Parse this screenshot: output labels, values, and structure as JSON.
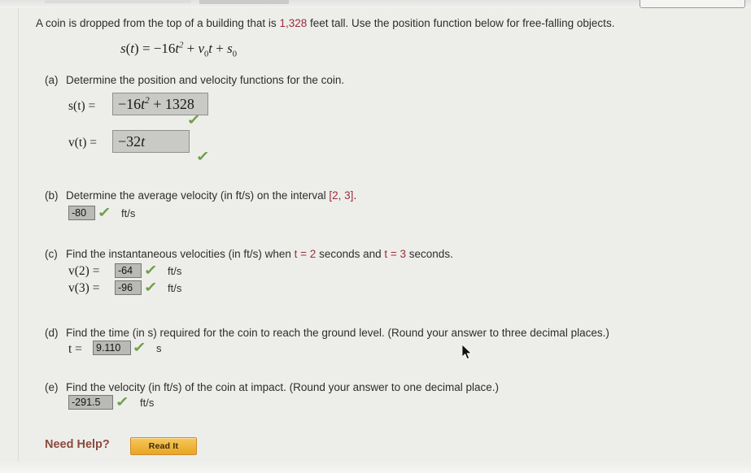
{
  "problem": {
    "text_before": "A coin is dropped from the top of a building that is ",
    "height_value": "1,328",
    "text_after": " feet tall. Use the position function below for free-falling objects.",
    "position_function": "s(t) = −16t² + v₀t + s₀"
  },
  "parts": {
    "a": {
      "label": "(a)",
      "text": "Determine the position and velocity functions for the coin.",
      "rows": [
        {
          "lhs": "s(t)  =",
          "value": "−16t² + 1328",
          "correct": true
        },
        {
          "lhs": "v(t)  =",
          "value": "−32t",
          "correct": true
        }
      ]
    },
    "b": {
      "label": "(b)",
      "text_before": "Determine the average velocity (in ft/s) on the interval ",
      "interval": "[2, 3]",
      "text_after": ".",
      "value": "-80",
      "units": "ft/s",
      "correct": true
    },
    "c": {
      "label": "(c)",
      "text_before": "Find the instantaneous velocities (in ft/s) when ",
      "t_first": "t = 2",
      "text_middle": " seconds and ",
      "t_second": "t = 3",
      "text_after": " seconds.",
      "rows": [
        {
          "lhs": "v(2)  =",
          "value": "-64",
          "units": "ft/s",
          "correct": true
        },
        {
          "lhs": "v(3)  =",
          "value": "-96",
          "units": "ft/s",
          "correct": true
        }
      ]
    },
    "d": {
      "label": "(d)",
      "text": "Find the time (in s) required for the coin to reach the ground level. (Round your answer to three decimal places.)",
      "lhs": "t  =",
      "value": "9.110",
      "units": "s",
      "correct": true
    },
    "e": {
      "label": "(e)",
      "text": "Find the velocity (in ft/s) of the coin at impact. (Round your answer to one decimal place.)",
      "value": "-291.5",
      "units": "ft/s",
      "correct": true
    }
  },
  "help": {
    "label": "Need Help?",
    "button_label": "Read It"
  },
  "icons": {
    "check": "✓"
  },
  "colors": {
    "accent_red": "#9e2a3a",
    "check_green": "#6f9e49",
    "help_brown": "#8c4a3c",
    "button_orange": "#e8a522",
    "page_background": "#edeeea"
  }
}
